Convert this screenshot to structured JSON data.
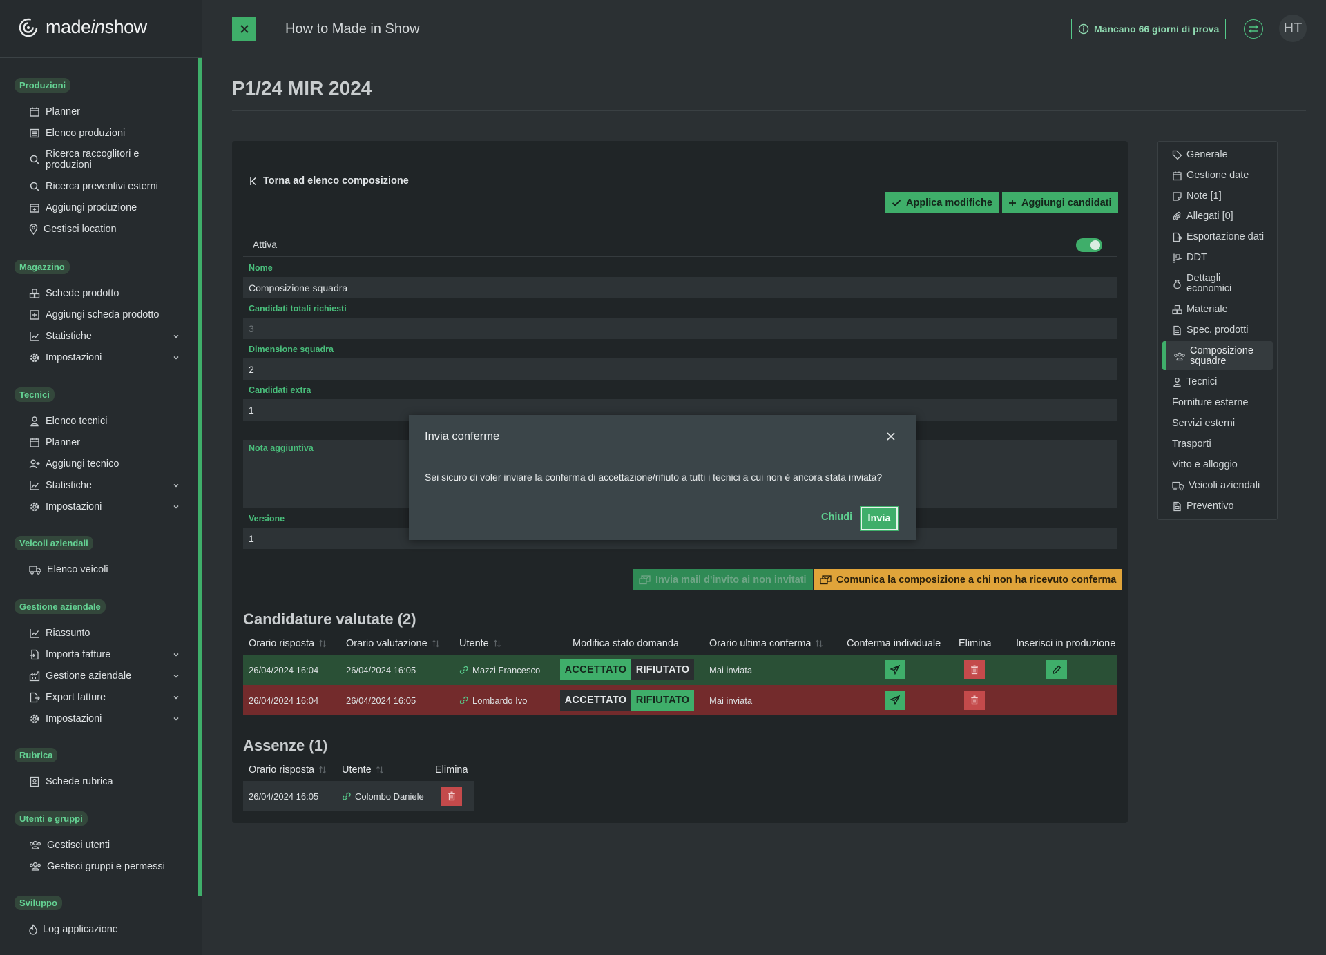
{
  "brand": {
    "name_pre": "made",
    "name_it": "in",
    "name_post": "show"
  },
  "header": {
    "title": "How to Made in Show",
    "trial": "Mancano 66 giorni di prova",
    "avatar": "HT"
  },
  "sidebar": {
    "sections": [
      {
        "title": "Produzioni",
        "items": [
          {
            "label": "Planner",
            "icon": "calendar-icon"
          },
          {
            "label": "Elenco produzioni",
            "icon": "list-icon"
          },
          {
            "label": "Ricerca raccoglitori e produzioni",
            "icon": "search-icon"
          },
          {
            "label": "Ricerca preventivi esterni",
            "icon": "search-icon"
          },
          {
            "label": "Aggiungi produzione",
            "icon": "calendar-plus-icon"
          },
          {
            "label": "Gestisci location",
            "icon": "location-pin-icon"
          }
        ]
      },
      {
        "title": "Magazzino",
        "items": [
          {
            "label": "Schede prodotto",
            "icon": "boxes-icon"
          },
          {
            "label": "Aggiungi scheda prodotto",
            "icon": "plus-square-icon"
          },
          {
            "label": "Statistiche",
            "icon": "chart-line-icon"
          },
          {
            "label": "Impostazioni",
            "icon": "gear-icon"
          }
        ]
      },
      {
        "title": "Tecnici",
        "items": [
          {
            "label": "Elenco tecnici",
            "icon": "user-icon"
          },
          {
            "label": "Planner",
            "icon": "calendar-icon"
          },
          {
            "label": "Aggiungi tecnico",
            "icon": "user-plus-icon"
          },
          {
            "label": "Statistiche",
            "icon": "chart-line-icon"
          },
          {
            "label": "Impostazioni",
            "icon": "gear-icon"
          }
        ]
      },
      {
        "title": "Veicoli aziendali",
        "items": [
          {
            "label": "Elenco veicoli",
            "icon": "truck-icon"
          }
        ]
      },
      {
        "title": "Gestione aziendale",
        "items": [
          {
            "label": "Riassunto",
            "icon": "chart-line-icon"
          },
          {
            "label": "Importa fatture",
            "icon": "file-import-icon"
          },
          {
            "label": "Gestione aziendale",
            "icon": "building-icon"
          },
          {
            "label": "Export fatture",
            "icon": "file-export-icon"
          },
          {
            "label": "Impostazioni",
            "icon": "gear-icon"
          }
        ]
      },
      {
        "title": "Rubrica",
        "items": [
          {
            "label": "Schede rubrica",
            "icon": "address-book-icon"
          }
        ]
      },
      {
        "title": "Utenti e gruppi",
        "items": [
          {
            "label": "Gestisci utenti",
            "icon": "users-icon"
          },
          {
            "label": "Gestisci gruppi e permessi",
            "icon": "users-icon"
          }
        ]
      },
      {
        "title": "Sviluppo",
        "items": [
          {
            "label": "Log applicazione",
            "icon": "fire-icon"
          }
        ]
      }
    ]
  },
  "page": {
    "title": "P1/24 MIR 2024"
  },
  "composition": {
    "back": "Torna ad elenco composizione",
    "apply": "Applica modifiche",
    "add_candidates": "Aggiungi candidati",
    "active_label": "Attiva",
    "active": true,
    "fields": {
      "nome_label": "Nome",
      "nome_value": "Composizione squadra",
      "totali_label": "Candidati totali richiesti",
      "totali_value": "3",
      "dimensione_label": "Dimensione squadra",
      "dimensione_value": "2",
      "extra_label": "Candidati extra",
      "extra_value": "1",
      "nota_label": "Nota aggiuntiva",
      "nota_value": "",
      "versione_label": "Versione",
      "versione_value": "1"
    },
    "invite_btn": "Invia mail d'invito ai non invitati",
    "notify_btn": "Comunica la composizione a chi non ha ricevuto conferma"
  },
  "candidature": {
    "title": "Candidature valutate (2)",
    "columns": [
      "Orario risposta",
      "Orario valutazione",
      "Utente",
      "Modifica stato domanda",
      "Orario ultima conferma",
      "Conferma individuale",
      "Elimina",
      "Inserisci in produzione"
    ],
    "accept_label": "ACCETTATO",
    "reject_label": "RIFIUTATO",
    "rows": [
      {
        "risposta": "26/04/2024 16:04",
        "valutazione": "26/04/2024 16:05",
        "utente": "Mazzi Francesco",
        "stato": "accettato",
        "conferma": "Mai inviata"
      },
      {
        "risposta": "26/04/2024 16:04",
        "valutazione": "26/04/2024 16:05",
        "utente": "Lombardo Ivo",
        "stato": "rifiutato",
        "conferma": "Mai inviata"
      }
    ]
  },
  "assenze": {
    "title": "Assenze (1)",
    "columns": [
      "Orario risposta",
      "Utente",
      "Elimina"
    ],
    "rows": [
      {
        "risposta": "26/04/2024 16:05",
        "utente": "Colombo Daniele"
      }
    ]
  },
  "right_nav": {
    "items": [
      {
        "label": "Generale",
        "icon": "tag-icon"
      },
      {
        "label": "Gestione date",
        "icon": "calendar-icon"
      },
      {
        "label": "Note [1]",
        "icon": "note-icon"
      },
      {
        "label": "Allegati [0]",
        "icon": "paperclip-icon"
      },
      {
        "label": "Esportazione dati",
        "icon": "file-export-icon"
      },
      {
        "label": "DDT",
        "icon": "truck-ramp-icon"
      },
      {
        "label": "Dettagli economici",
        "icon": "money-bag-icon"
      },
      {
        "label": "Materiale",
        "icon": "boxes-icon"
      },
      {
        "label": "Spec. prodotti",
        "icon": "file-icon"
      },
      {
        "label": "Composizione squadre",
        "icon": "users-icon"
      },
      {
        "label": "Tecnici",
        "icon": "user-icon"
      },
      {
        "label": "Forniture esterne",
        "icon": ""
      },
      {
        "label": "Servizi esterni",
        "icon": ""
      },
      {
        "label": "Trasporti",
        "icon": ""
      },
      {
        "label": "Vitto e alloggio",
        "icon": ""
      },
      {
        "label": "Veicoli aziendali",
        "icon": "truck-icon"
      },
      {
        "label": "Preventivo",
        "icon": "file-invoice-icon"
      }
    ]
  },
  "modal": {
    "title": "Invia conferme",
    "body": "Sei sicuro di voler inviare la conferma di accettazione/rifiuto a tutti i tecnici a cui non è ancora stata inviata?",
    "cancel": "Chiudi",
    "confirm": "Invia"
  },
  "colors": {
    "accent": "#3fae6a",
    "warning": "#e0a43a",
    "danger": "#c44a4b",
    "bg": "#2b3033"
  }
}
